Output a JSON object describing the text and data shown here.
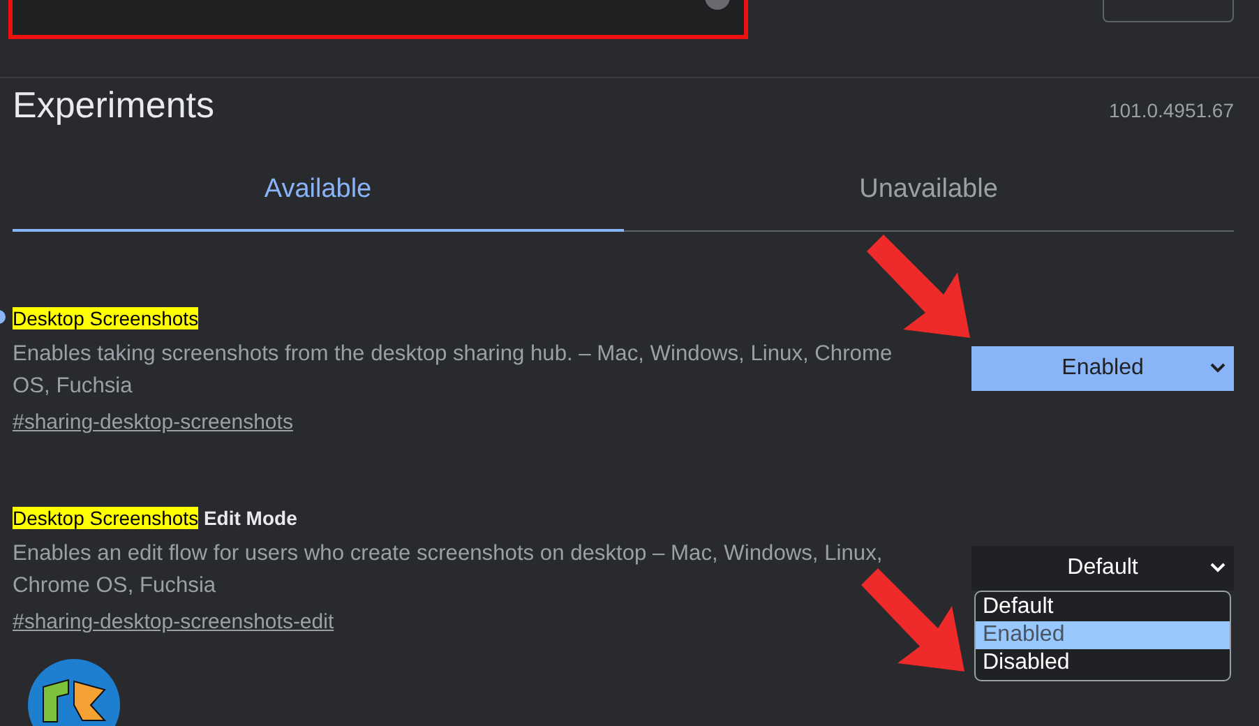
{
  "header": {
    "search": {
      "highlighted": true
    }
  },
  "title": "Experiments",
  "version": "101.0.4951.67",
  "tabs": [
    {
      "label": "Available",
      "selected": true
    },
    {
      "label": "Unavailable",
      "selected": false
    }
  ],
  "experiments": [
    {
      "name_parts": [
        {
          "text": "Desktop Screenshots",
          "match": true
        }
      ],
      "active": true,
      "description": "Enables taking screenshots from the desktop sharing hub. – Mac, Windows, Linux, Chrome OS, Fuchsia",
      "link": "#sharing-desktop-screenshots",
      "select": {
        "value": "Enabled",
        "changed": true
      }
    },
    {
      "name_parts": [
        {
          "text": "Desktop Screenshots",
          "match": true
        },
        {
          "text": " Edit Mode",
          "match": false
        }
      ],
      "active": false,
      "description": "Enables an edit flow for users who create screenshots on desktop – Mac, Windows, Linux, Chrome OS, Fuchsia",
      "link": "#sharing-desktop-screenshots-edit",
      "select": {
        "value": "Default",
        "changed": false,
        "options": [
          {
            "label": "Default",
            "highlighted": false
          },
          {
            "label": "Enabled",
            "highlighted": true
          },
          {
            "label": "Disabled",
            "highlighted": false
          }
        ]
      }
    }
  ]
}
